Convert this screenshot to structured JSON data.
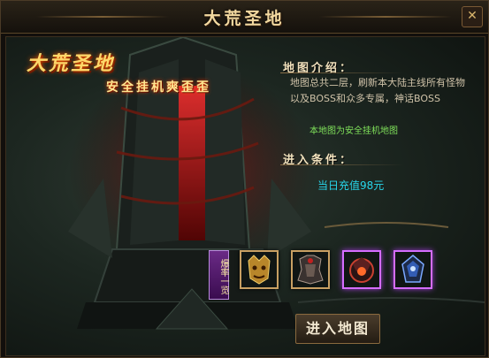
{
  "window": {
    "title": "大荒圣地",
    "close_glyph": "✕"
  },
  "banner": {
    "title": "大荒圣地",
    "subtitle": "安全挂机爽歪歪"
  },
  "intro": {
    "heading": "地图介绍：",
    "description": "地图总共二层，刷新本大陆主线所有怪物以及BOSS和众多专属，神话BOSS",
    "note": "本地图为安全挂机地图"
  },
  "entry": {
    "heading": "进入条件：",
    "requirement": "当日充值98元"
  },
  "rewards": {
    "label": "爆率一览",
    "items": [
      "gold-demon-mask",
      "dark-armor",
      "flame-helmet",
      "blue-crystal-relic"
    ]
  },
  "actions": {
    "enter_label": "进入地图"
  },
  "colors": {
    "accent_gold": "#ffd86a",
    "cyan_text": "#27d6ea",
    "green_text": "#7fe05a",
    "rare_border": "#d56dff"
  }
}
